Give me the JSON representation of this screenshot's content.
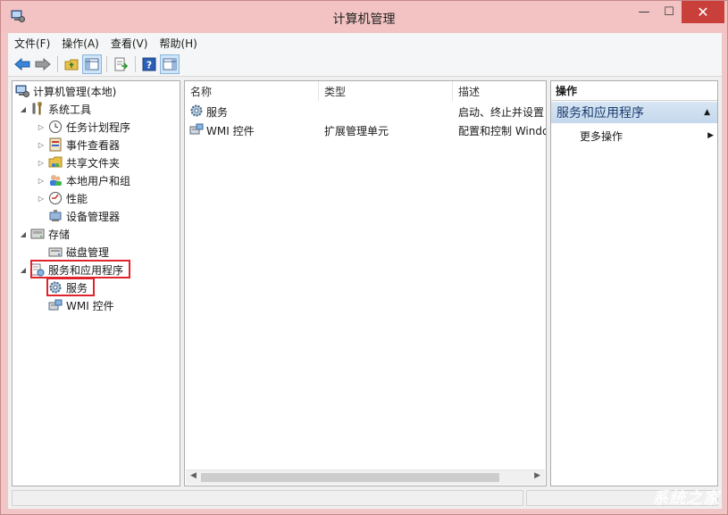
{
  "window": {
    "title": "计算机管理",
    "minimize": "—",
    "maximize": "☐",
    "close": "✕"
  },
  "menu": [
    "文件(F)",
    "操作(A)",
    "查看(V)",
    "帮助(H)"
  ],
  "tree": {
    "root": "计算机管理(本地)",
    "system_tools": "系统工具",
    "task_scheduler": "任务计划程序",
    "event_viewer": "事件查看器",
    "shared_folders": "共享文件夹",
    "local_users": "本地用户和组",
    "performance": "性能",
    "device_manager": "设备管理器",
    "storage": "存储",
    "disk_management": "磁盘管理",
    "services_apps": "服务和应用程序",
    "services": "服务",
    "wmi": "WMI 控件"
  },
  "list": {
    "columns": [
      "名称",
      "类型",
      "描述"
    ],
    "rows": [
      {
        "name": "服务",
        "type": "",
        "desc": "启动、终止并设置"
      },
      {
        "name": "WMI 控件",
        "type": "扩展管理单元",
        "desc": "配置和控制 Windo"
      }
    ]
  },
  "actions": {
    "header": "操作",
    "section": "服务和应用程序",
    "more": "更多操作"
  },
  "watermark": "系统之家",
  "colors": {
    "highlight_box": "#e0242c",
    "close_button": "#c9403a",
    "action_section": "#c5d8ec"
  }
}
